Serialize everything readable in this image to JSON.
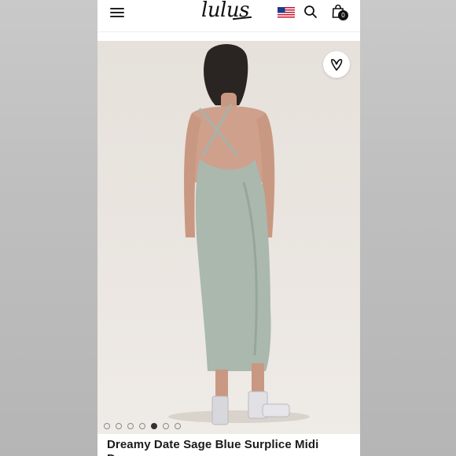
{
  "header": {
    "logo_text": "lulus",
    "cart_count": "0",
    "icons": [
      "menu-icon",
      "us-flag-icon",
      "search-icon",
      "shopping-bag-icon"
    ]
  },
  "gallery": {
    "image_description_icon": "favorite-heart-icon",
    "dot_count": 7,
    "active_dot": 5
  },
  "product": {
    "title": "Dreamy Date Sage Blue Surplice Midi",
    "title_continued": "D"
  },
  "colors": {
    "dress": "#aab8ae",
    "background": "#e9e4de",
    "text": "#1b1b1b"
  }
}
